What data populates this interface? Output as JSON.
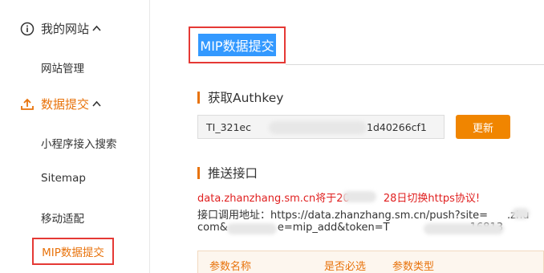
{
  "sidebar": {
    "group_site": {
      "label": "我的网站",
      "icon": "info-circle-icon"
    },
    "site_manage": "网站管理",
    "group_submit": {
      "label": "数据提交",
      "icon": "upload-icon"
    },
    "items": [
      "小程序接入搜索",
      "Sitemap",
      "移动适配"
    ],
    "active_item": "MIP数据提交"
  },
  "main": {
    "title": "MIP数据提交",
    "authkey_section": "获取Authkey",
    "authkey_left": "TI_321ec",
    "authkey_right": "1d40266cf1",
    "update_button": "更新",
    "push_section": "推送接口",
    "notice_a": "data.zhanzhang.sm.cn将于20",
    "notice_b": "28日切换https协议!",
    "endpoint_line1_a": "接口调用地址：https://data.zhanzhang.sm.cn/push?site=",
    "endpoint_line1_b": ".zhu",
    "endpoint_line2_a": "com&",
    "endpoint_line2_b": "e=mip_add&token=T",
    "endpoint_line2_c": "16813",
    "table_headers": [
      "参数名称",
      "是否必选",
      "参数类型"
    ]
  },
  "colors": {
    "accent": "#e8730c",
    "highlight": "#e53935",
    "selection": "#3399ff",
    "notice": "#e02020"
  }
}
